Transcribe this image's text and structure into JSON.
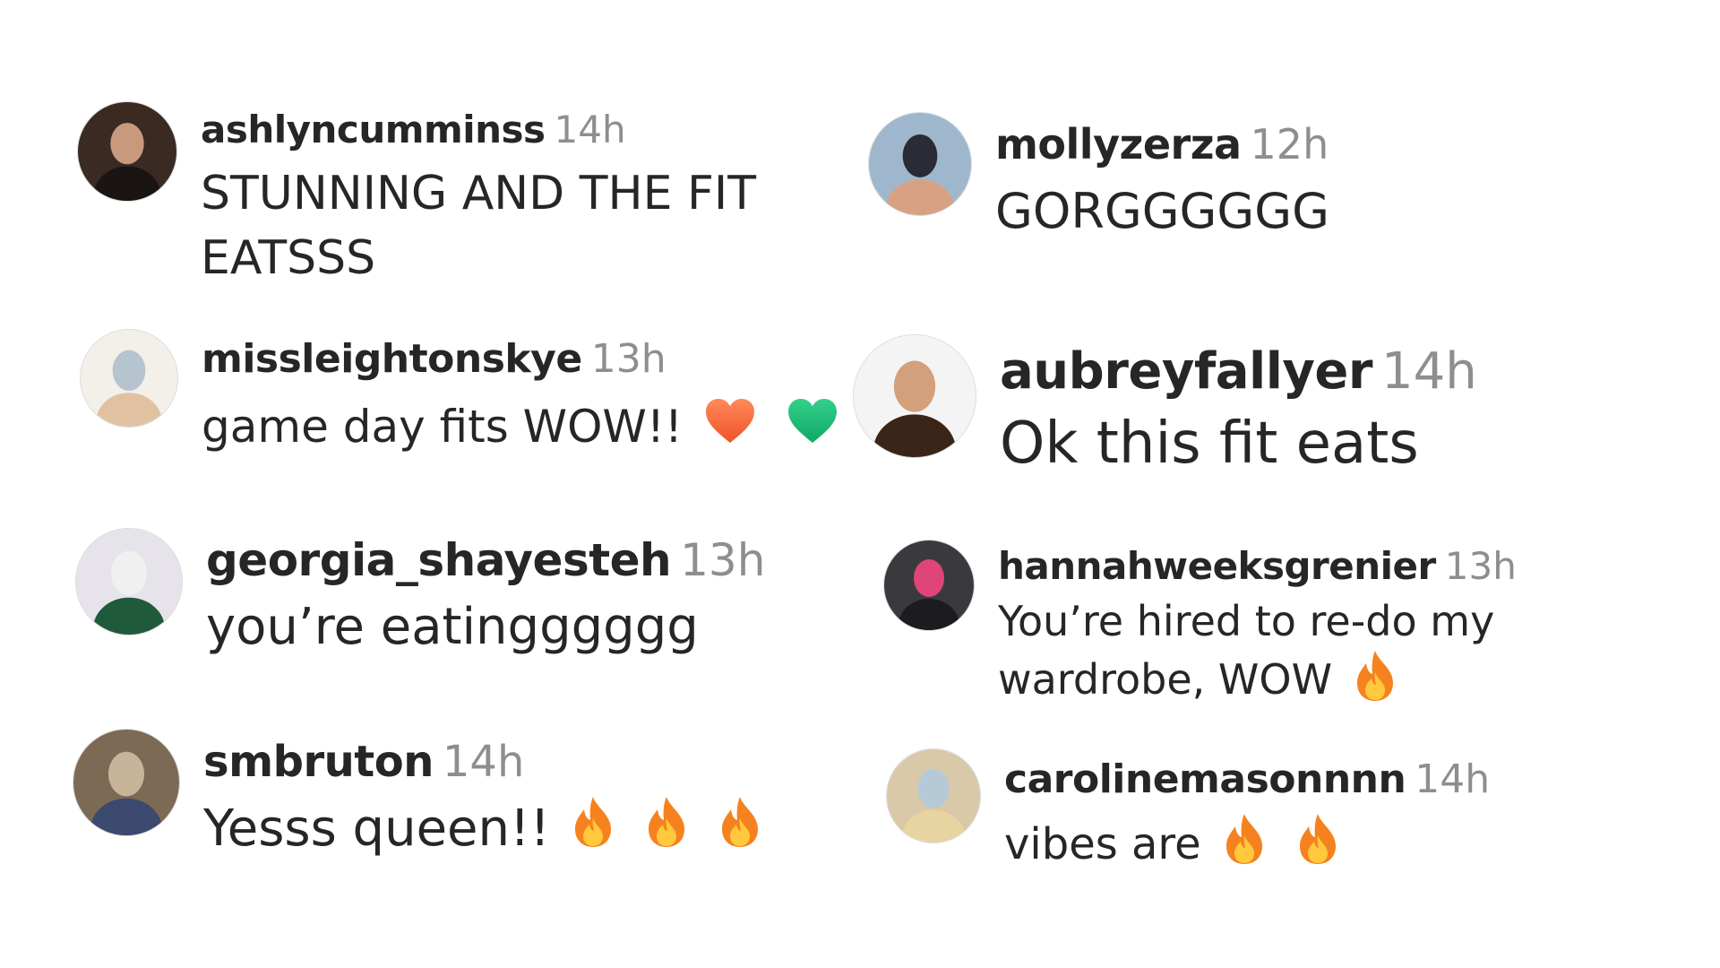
{
  "comments": [
    {
      "username": "ashlyncumminss",
      "time": "14h",
      "text": "STUNNING AND THE FIT EATSSS",
      "emojis": [],
      "avatar_colors": [
        "#3a2a22",
        "#1a1412",
        "#c79a7e"
      ]
    },
    {
      "username": "missleightonskye",
      "time": "13h",
      "text": "game day fits WOW!!",
      "emojis": [
        "heart-orange",
        "heart-green"
      ],
      "avatar_colors": [
        "#f3efe9",
        "#e0c2a3",
        "#b6c4cf"
      ]
    },
    {
      "username": "georgia_shayesteh",
      "time": "13h",
      "text": "you’re eatingggggg",
      "emojis": [],
      "avatar_colors": [
        "#e6e3ea",
        "#1f5a3c",
        "#f0f0f0"
      ]
    },
    {
      "username": "smbruton",
      "time": "14h",
      "text": "Yesss queen!!",
      "emojis": [
        "fire",
        "fire",
        "fire"
      ],
      "avatar_colors": [
        "#7d6a55",
        "#3b4a6e",
        "#c8b49a"
      ]
    },
    {
      "username": "mollyzerza",
      "time": "12h",
      "text": "GORGGGGGG",
      "emojis": [],
      "avatar_colors": [
        "#9fb7cc",
        "#d9a184",
        "#2b2b35"
      ]
    },
    {
      "username": "aubreyfallyer",
      "time": "14h",
      "text": "Ok this fit eats",
      "emojis": [],
      "avatar_colors": [
        "#f4f4f4",
        "#3b2418",
        "#d2a07a"
      ]
    },
    {
      "username": "hannahweeksgrenier",
      "time": "13h",
      "text": "You’re hired to re-do my wardrobe, WOW",
      "emojis": [
        "fire"
      ],
      "avatar_colors": [
        "#3a3a3e",
        "#1c1c1e",
        "#e0457a"
      ]
    },
    {
      "username": "carolinemasonnnn",
      "time": "14h",
      "text": "vibes are",
      "emojis": [
        "fire",
        "fire"
      ],
      "avatar_colors": [
        "#d9c9a8",
        "#e8d4a0",
        "#b5cad6"
      ]
    }
  ]
}
